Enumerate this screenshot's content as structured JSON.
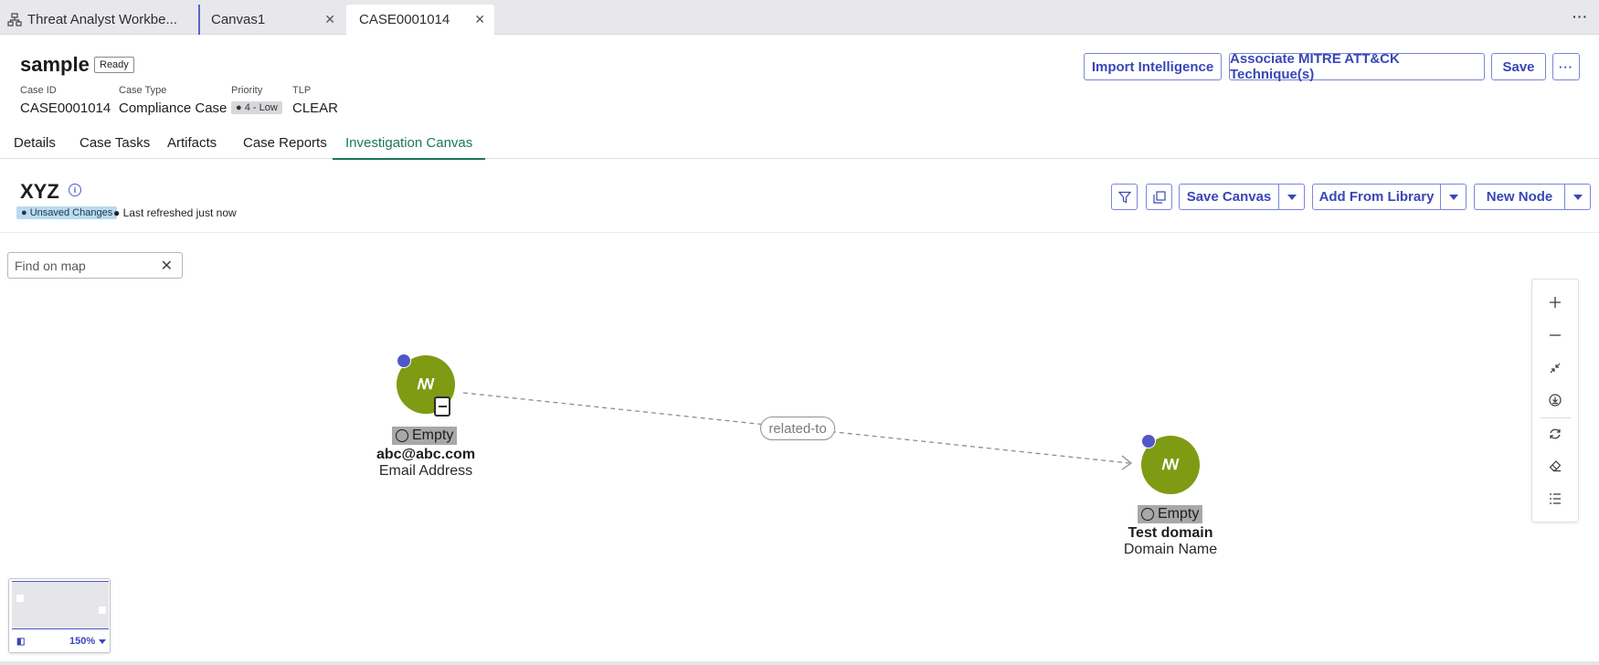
{
  "tabs": [
    {
      "label": "Threat Analyst Workbe..."
    },
    {
      "label": "Canvas1"
    },
    {
      "label": "CASE0001014"
    }
  ],
  "header": {
    "title": "sample",
    "status": "Ready",
    "meta": {
      "case_id_label": "Case ID",
      "case_id": "CASE0001014",
      "case_type_label": "Case Type",
      "case_type": "Compliance Case",
      "priority_label": "Priority",
      "priority": "4 - Low",
      "tlp_label": "TLP",
      "tlp": "CLEAR"
    },
    "buttons": {
      "import": "Import Intelligence",
      "mitre": "Associate MITRE ATT&CK Technique(s)",
      "save": "Save",
      "more": "···"
    }
  },
  "section_tabs": [
    "Details",
    "Case Tasks",
    "Artifacts",
    "Case Reports",
    "Investigation Canvas"
  ],
  "canvas": {
    "title": "XYZ",
    "unsaved": "Unsaved Changes",
    "refreshed": "Last refreshed just now",
    "buttons": {
      "save_canvas": "Save Canvas",
      "add_from_library": "Add From Library",
      "new_node": "New Node"
    },
    "find_placeholder": "Find on map",
    "edge_label": "related-to",
    "nodes": [
      {
        "status": "Empty",
        "name": "abc@abc.com",
        "type": "Email Address"
      },
      {
        "status": "Empty",
        "name": "Test domain",
        "type": "Domain Name"
      }
    ],
    "zoom": "150%"
  },
  "colors": {
    "accent": "#3946b8",
    "active_tab": "#1b7a55",
    "node_fill": "#7f9a13",
    "node_dot": "#5057c7"
  }
}
